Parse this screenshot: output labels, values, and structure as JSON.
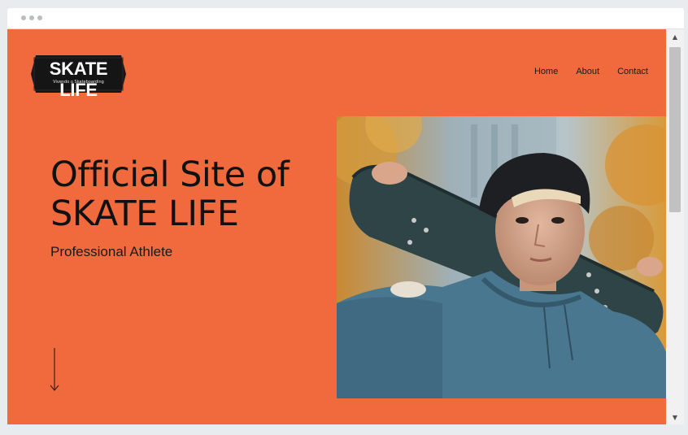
{
  "browser": {
    "window_controls": [
      "dot",
      "dot",
      "dot"
    ]
  },
  "logo": {
    "title": "SKATE LIFE",
    "tagline": "Vivendo o Skateboarding"
  },
  "nav": {
    "items": [
      {
        "label": "Home"
      },
      {
        "label": "About"
      },
      {
        "label": "Contact"
      }
    ]
  },
  "hero": {
    "title_line1": "Official Site of",
    "title_line2": "SKATE LIFE",
    "subtitle": "Professional Athlete"
  },
  "colors": {
    "background": "#f06a3d",
    "text": "#111111"
  },
  "icons": {
    "scroll_indicator": "arrow-down-icon"
  }
}
